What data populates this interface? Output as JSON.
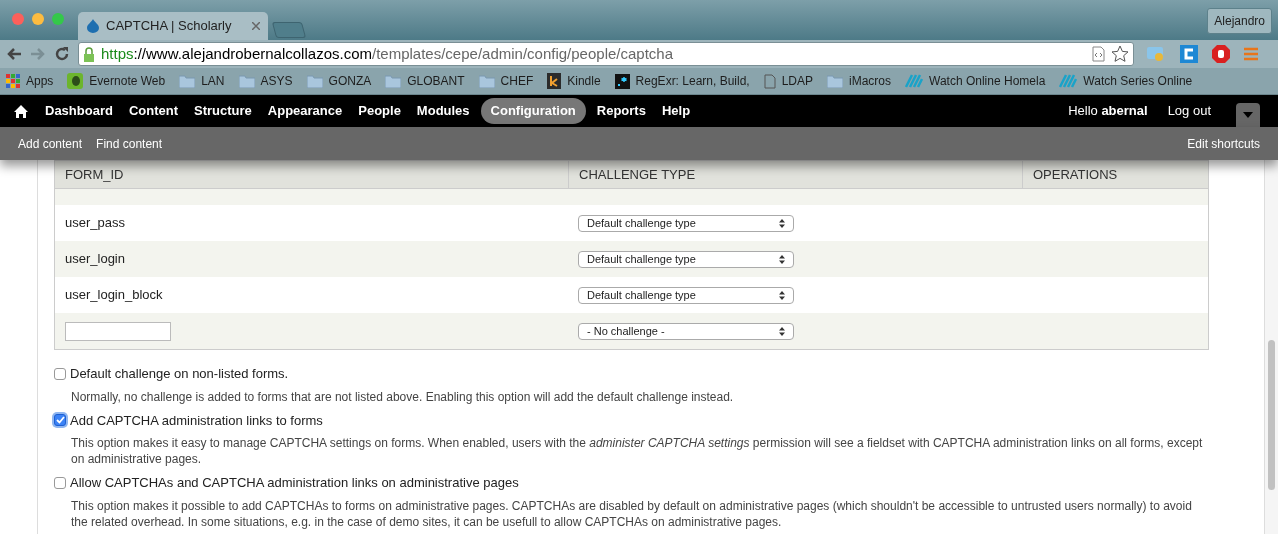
{
  "browser": {
    "tab": {
      "title": "CAPTCHA | Scholarly"
    },
    "profile": "Alejandro",
    "address": {
      "scheme": "https",
      "host": "://www.alejandrobernalcollazos.com",
      "path": "/templates/cepe/admin/config/people/captcha"
    },
    "bookmarks": [
      {
        "kind": "apps",
        "label": "Apps"
      },
      {
        "kind": "evernote",
        "label": "Evernote Web"
      },
      {
        "kind": "folder",
        "label": "LAN"
      },
      {
        "kind": "folder",
        "label": "ASYS"
      },
      {
        "kind": "folder",
        "label": "GONZA"
      },
      {
        "kind": "folder",
        "label": "GLOBANT"
      },
      {
        "kind": "folder",
        "label": "CHEF"
      },
      {
        "kind": "kindle",
        "label": "Kindle"
      },
      {
        "kind": "regexr",
        "label": "RegExr: Learn, Build,"
      },
      {
        "kind": "page",
        "label": "LDAP"
      },
      {
        "kind": "folder",
        "label": "iMacros"
      },
      {
        "kind": "watch",
        "label": "Watch Online Homela"
      },
      {
        "kind": "watch",
        "label": "Watch Series Online"
      }
    ]
  },
  "admin_menu": {
    "items": [
      {
        "label": "Dashboard",
        "selected": false
      },
      {
        "label": "Content",
        "selected": false
      },
      {
        "label": "Structure",
        "selected": false
      },
      {
        "label": "Appearance",
        "selected": false
      },
      {
        "label": "People",
        "selected": false
      },
      {
        "label": "Modules",
        "selected": false
      },
      {
        "label": "Configuration",
        "selected": true
      },
      {
        "label": "Reports",
        "selected": false
      },
      {
        "label": "Help",
        "selected": false
      }
    ],
    "greeting": "Hello **abernal**",
    "logout": "Log out"
  },
  "shortcuts": {
    "items": [
      "Add content",
      "Find content"
    ],
    "edit": "Edit shortcuts"
  },
  "table": {
    "columns": [
      "FORM_ID",
      "CHALLENGE TYPE",
      "OPERATIONS"
    ],
    "rows": [
      {
        "kind": "text",
        "form_id": "user_pass",
        "challenge": "Default challenge type"
      },
      {
        "kind": "text",
        "form_id": "user_login",
        "challenge": "Default challenge type"
      },
      {
        "kind": "text",
        "form_id": "user_login_block",
        "challenge": "Default challenge type"
      },
      {
        "kind": "input",
        "challenge": "- No challenge -"
      }
    ]
  },
  "options": [
    {
      "label": "Default challenge on non-listed forms.",
      "checked": false,
      "description": "Normally, no challenge is added to forms that are not listed above. Enabling this option will add the default challenge instead."
    },
    {
      "label": "Add CAPTCHA administration links to forms",
      "checked": true,
      "description": "This option makes it easy to manage CAPTCHA settings on forms. When enabled, users with the *administer CAPTCHA settings* permission will see a fieldset with CAPTCHA administration links on all forms, except on administrative pages."
    },
    {
      "label": "Allow CAPTCHAs and CAPTCHA administration links on administrative pages",
      "checked": false,
      "description": "This option makes it possible to add CAPTCHAs to forms on administrative pages. CAPTCHAs are disabled by default on administrative pages (which shouldn't be accessible to untrusted users normally) to avoid the related overhead. In some situations, e.g. in the case of demo sites, it can be usefull to allow CAPTCHAs on administrative pages."
    }
  ]
}
